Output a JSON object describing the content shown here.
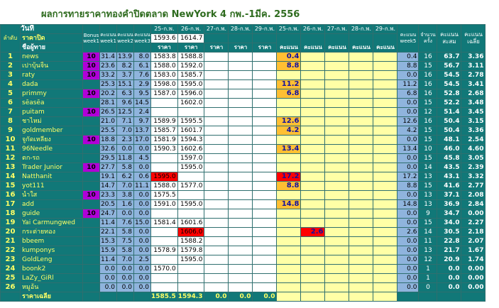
{
  "title": "ผลการทายราคาทองคำปิดตลาด NewYork 4 กพ.-1มีค. 2556",
  "headers": {
    "index": "ลำดับ",
    "day": "วันที่",
    "close_price": "ราคาปิด",
    "guesser": "ชื่อผู้ทาย",
    "bonus": "Bonus week1",
    "score_w1": "คะแนน week1",
    "score_w2": "คะแนน week2",
    "score_w3": "คะแนน week3",
    "d25": "25-ก.พ.",
    "d26": "26-ก.พ.",
    "d27": "27-ก.พ.",
    "d28": "28-ก.พ.",
    "d29": "29-ก.พ.",
    "price": "ราคา",
    "score": "คะแนน",
    "score_w5": "คะแนน week5",
    "count": "จำนวนครั้ง",
    "total": "คะแนนสะสม",
    "avg": "คะแนนเฉลี่ย",
    "close25": "1593.6",
    "close26": "1614.7",
    "avg_label": "ราคาเฉลี่ย"
  },
  "rows": [
    {
      "n": "1",
      "name": "news",
      "bonus": "10",
      "w1": "31.4",
      "w2": "13.9",
      "w3": "8.0",
      "p25": "1583.8",
      "p26": "1588.8",
      "s25": "0.4",
      "w5": "0.4",
      "cnt": "16",
      "tot": "63.7",
      "avg": "3.36",
      "s25o": true
    },
    {
      "n": "2",
      "name": "เปาบุ้นจิ้น",
      "bonus": "10",
      "w1": "23.6",
      "w2": "8.2",
      "w3": "6.1",
      "p25": "1588.0",
      "p26": "1592.0",
      "s25": "8.8",
      "w5": "8.8",
      "cnt": "15",
      "tot": "56.7",
      "avg": "3.11",
      "s25o": true
    },
    {
      "n": "3",
      "name": "raty",
      "bonus": "10",
      "w1": "33.2",
      "w2": "3.7",
      "w3": "7.6",
      "p25": "1583.0",
      "p26": "1585.7",
      "s25": "",
      "w5": "0.0",
      "cnt": "16",
      "tot": "54.5",
      "avg": "2.78"
    },
    {
      "n": "4",
      "name": "dada",
      "bonus": "",
      "w1": "25.3",
      "w2": "15.1",
      "w3": "2.9",
      "p25": "1598.0",
      "p26": "1595.0",
      "s25": "11.2",
      "w5": "11.2",
      "cnt": "16",
      "tot": "54.5",
      "avg": "3.41",
      "s25o": true
    },
    {
      "n": "5",
      "name": "primmy",
      "bonus": "10",
      "w1": "20.2",
      "w2": "6.3",
      "w3": "9.5",
      "p25": "1587.0",
      "p26": "1596.0",
      "s25": "6.8",
      "w5": "6.8",
      "cnt": "16",
      "tot": "52.8",
      "avg": "2.68",
      "s25o": true
    },
    {
      "n": "6",
      "name": "sēasēa",
      "bonus": "",
      "w1": "28.1",
      "w2": "9.6",
      "w3": "14.5",
      "p25": "",
      "p26": "1602.0",
      "s25": "",
      "w5": "0.0",
      "cnt": "15",
      "tot": "52.2",
      "avg": "3.48"
    },
    {
      "n": "7",
      "name": "puitam",
      "bonus": "10",
      "w1": "26.5",
      "w2": "12.5",
      "w3": "2.4",
      "p25": "",
      "p26": "",
      "s25": "",
      "w5": "0.0",
      "cnt": "12",
      "tot": "51.4",
      "avg": "3.45"
    },
    {
      "n": "8",
      "name": "ชาไหม่",
      "bonus": "",
      "w1": "21.0",
      "w2": "7.1",
      "w3": "9.7",
      "p25": "1589.9",
      "p26": "1595.5",
      "s25": "12.6",
      "w5": "12.6",
      "cnt": "16",
      "tot": "50.4",
      "avg": "3.15",
      "s25o": true
    },
    {
      "n": "9",
      "name": "goldmember",
      "bonus": "",
      "w1": "25.5",
      "w2": "7.0",
      "w3": "13.7",
      "p25": "1585.7",
      "p26": "1601.7",
      "s25": "4.2",
      "w5": "4.2",
      "cnt": "15",
      "tot": "50.4",
      "avg": "3.36",
      "s25o": true
    },
    {
      "n": "10",
      "name": "จูกัดเหลียง",
      "bonus": "10",
      "w1": "18.8",
      "w2": "2.3",
      "w3": "17.0",
      "p25": "1581.9",
      "p26": "1594.3",
      "s25": "",
      "w5": "0.0",
      "cnt": "15",
      "tot": "48.1",
      "avg": "2.54"
    },
    {
      "n": "11",
      "name": "96Needle",
      "bonus": "",
      "w1": "32.6",
      "w2": "0.0",
      "w3": "0.0",
      "p25": "1590.3",
      "p26": "1602.6",
      "s25": "13.4",
      "w5": "13.4",
      "cnt": "10",
      "tot": "46.0",
      "avg": "4.60",
      "s25o": true
    },
    {
      "n": "12",
      "name": "ตก-รถ",
      "bonus": "",
      "w1": "29.5",
      "w2": "11.8",
      "w3": "4.5",
      "p25": "",
      "p26": "1597.0",
      "s25": "",
      "w5": "0.0",
      "cnt": "15",
      "tot": "45.8",
      "avg": "3.05"
    },
    {
      "n": "13",
      "name": "Trader Junior",
      "bonus": "10",
      "w1": "27.7",
      "w2": "5.8",
      "w3": "0.0",
      "p25": "",
      "p26": "1595.0",
      "s25": "",
      "w5": "0.0",
      "cnt": "14",
      "tot": "43.5",
      "avg": "2.39"
    },
    {
      "n": "14",
      "name": "Natthanit",
      "bonus": "",
      "w1": "19.1",
      "w2": "6.2",
      "w3": "0.6",
      "p25": "1595.0",
      "p26": "",
      "s25": "17.2",
      "w5": "17.2",
      "cnt": "13",
      "tot": "43.1",
      "avg": "3.32",
      "p25r": true,
      "s25r": true
    },
    {
      "n": "15",
      "name": "yot111",
      "bonus": "",
      "w1": "14.7",
      "w2": "7.0",
      "w3": "11.1",
      "p25": "1588.0",
      "p26": "1577.0",
      "s25": "8.8",
      "w5": "8.8",
      "cnt": "15",
      "tot": "41.6",
      "avg": "2.77",
      "s25o": true
    },
    {
      "n": "16",
      "name": "น้ำใส",
      "bonus": "10",
      "w1": "23.3",
      "w2": "3.8",
      "w3": "0.0",
      "p25": "1575.5",
      "p26": "",
      "s25": "",
      "w5": "0.0",
      "cnt": "13",
      "tot": "37.1",
      "avg": "2.08"
    },
    {
      "n": "17",
      "name": "add",
      "bonus": "",
      "w1": "20.5",
      "w2": "1.6",
      "w3": "0.0",
      "p25": "1591.0",
      "p26": "1595.0",
      "s25": "14.8",
      "w5": "14.8",
      "cnt": "13",
      "tot": "36.9",
      "avg": "2.84",
      "s25o": true
    },
    {
      "n": "18",
      "name": "guide",
      "bonus": "10",
      "w1": "24.7",
      "w2": "0.0",
      "w3": "0.0",
      "p25": "",
      "p26": "",
      "s25": "",
      "w5": "0.0",
      "cnt": "9",
      "tot": "34.7",
      "avg": "0.00"
    },
    {
      "n": "19",
      "name": "Yai Carmungwed",
      "bonus": "",
      "w1": "11.4",
      "w2": "7.6",
      "w3": "15.0",
      "p25": "1581.4",
      "p26": "1601.6",
      "s25": "",
      "w5": "0.0",
      "cnt": "15",
      "tot": "34.0",
      "avg": "2.27"
    },
    {
      "n": "20",
      "name": "กระต่ายทอง",
      "bonus": "",
      "w1": "22.1",
      "w2": "5.8",
      "w3": "0.0",
      "p25": "",
      "p26": "1606.0",
      "s25": "",
      "w5": "2.6",
      "cnt": "14",
      "tot": "30.5",
      "avg": "2.18",
      "p26r": true,
      "s26": "2.6"
    },
    {
      "n": "21",
      "name": "bbeem",
      "bonus": "",
      "w1": "15.3",
      "w2": "7.5",
      "w3": "0.0",
      "p25": "",
      "p26": "1588.2",
      "s25": "",
      "w5": "0.0",
      "cnt": "11",
      "tot": "22.8",
      "avg": "2.07"
    },
    {
      "n": "22",
      "name": "kumponys",
      "bonus": "",
      "w1": "15.9",
      "w2": "5.8",
      "w3": "0.0",
      "p25": "1578.9",
      "p26": "1579.8",
      "s25": "",
      "w5": "0.0",
      "cnt": "13",
      "tot": "21.7",
      "avg": "1.67"
    },
    {
      "n": "23",
      "name": "GoldLeng",
      "bonus": "",
      "w1": "11.4",
      "w2": "7.0",
      "w3": "2.5",
      "p25": "",
      "p26": "1595.0",
      "s25": "",
      "w5": "0.0",
      "cnt": "12",
      "tot": "20.9",
      "avg": "1.74"
    },
    {
      "n": "24",
      "name": "boonk2",
      "bonus": "",
      "w1": "0.0",
      "w2": "0.0",
      "w3": "0.0",
      "p25": "1570.0",
      "p26": "",
      "s25": "",
      "w5": "0.0",
      "cnt": "1",
      "tot": "0.0",
      "avg": "0.00"
    },
    {
      "n": "25",
      "name": "LaZy_GiRl",
      "bonus": "",
      "w1": "0.0",
      "w2": "0.0",
      "w3": "0.0",
      "p25": "",
      "p26": "",
      "s25": "",
      "w5": "0.0",
      "cnt": "1",
      "tot": "0.0",
      "avg": "0.00"
    },
    {
      "n": "26",
      "name": "หมูอ้น",
      "bonus": "",
      "w1": "0.0",
      "w2": "0.0",
      "w3": "0.0",
      "p25": "",
      "p26": "",
      "s25": "",
      "w5": "0.0",
      "cnt": "0",
      "tot": "0.0",
      "avg": "0.00"
    }
  ],
  "footer": {
    "a25": "1585.5",
    "a26": "1594.3",
    "a27": "0.0",
    "a28": "0.0",
    "a29": "0.0"
  },
  "colors": {
    "teal": "#117878",
    "blue": "#8fb4dd",
    "yellow": "#ffffa6",
    "orange": "#ffbf33",
    "red": "#ff0000",
    "purple": "#b000d8",
    "title": "#2e6b1e"
  }
}
